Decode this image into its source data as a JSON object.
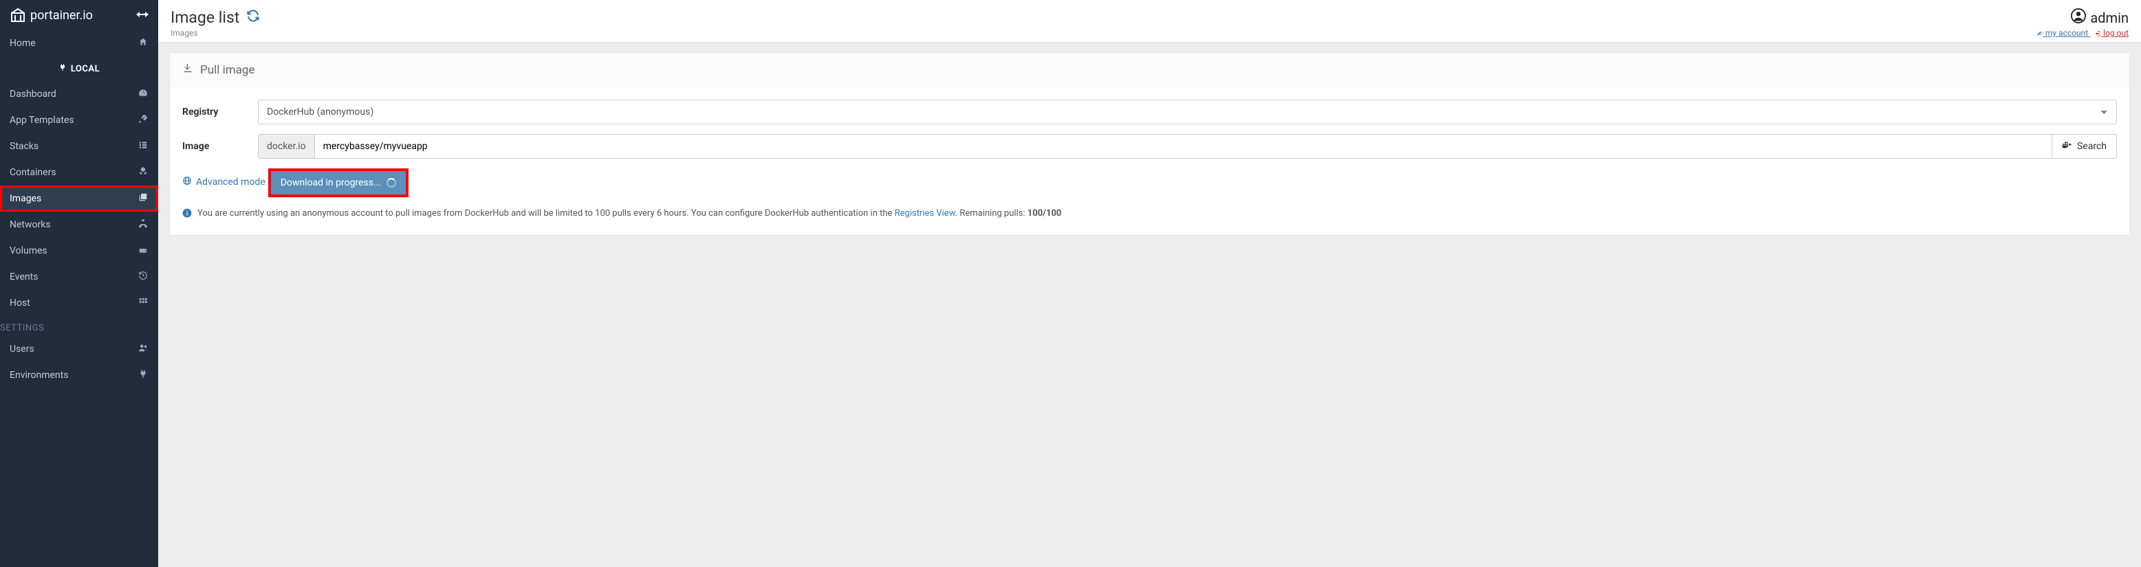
{
  "brand": "portainer.io",
  "sidebar": {
    "home": "Home",
    "local_header": "LOCAL",
    "items": [
      {
        "label": "Dashboard"
      },
      {
        "label": "App Templates"
      },
      {
        "label": "Stacks"
      },
      {
        "label": "Containers"
      },
      {
        "label": "Images"
      },
      {
        "label": "Networks"
      },
      {
        "label": "Volumes"
      },
      {
        "label": "Events"
      },
      {
        "label": "Host"
      }
    ],
    "settings_header": "SETTINGS",
    "settings": [
      {
        "label": "Users"
      },
      {
        "label": "Environments"
      }
    ]
  },
  "header": {
    "title": "Image list",
    "breadcrumb": "Images",
    "user": "admin",
    "my_account": " my account ",
    "log_out": " log out"
  },
  "panel": {
    "title": "Pull image",
    "form": {
      "registry_label": "Registry",
      "registry_value": "DockerHub (anonymous)",
      "image_label": "Image",
      "image_prefix": "docker.io",
      "image_value": "mercybassey/myvueapp",
      "search_label": "Search"
    },
    "advanced": "Advanced mode",
    "download_label": "Download in progress...",
    "note_prefix": "You are currently using an anonymous account to pull images from DockerHub and will be limited to 100 pulls every 6 hours. You can configure DockerHub authentication in the ",
    "note_link": "Registries View",
    "note_suffix_a": ". Remaining pulls: ",
    "note_count": "100/100"
  }
}
